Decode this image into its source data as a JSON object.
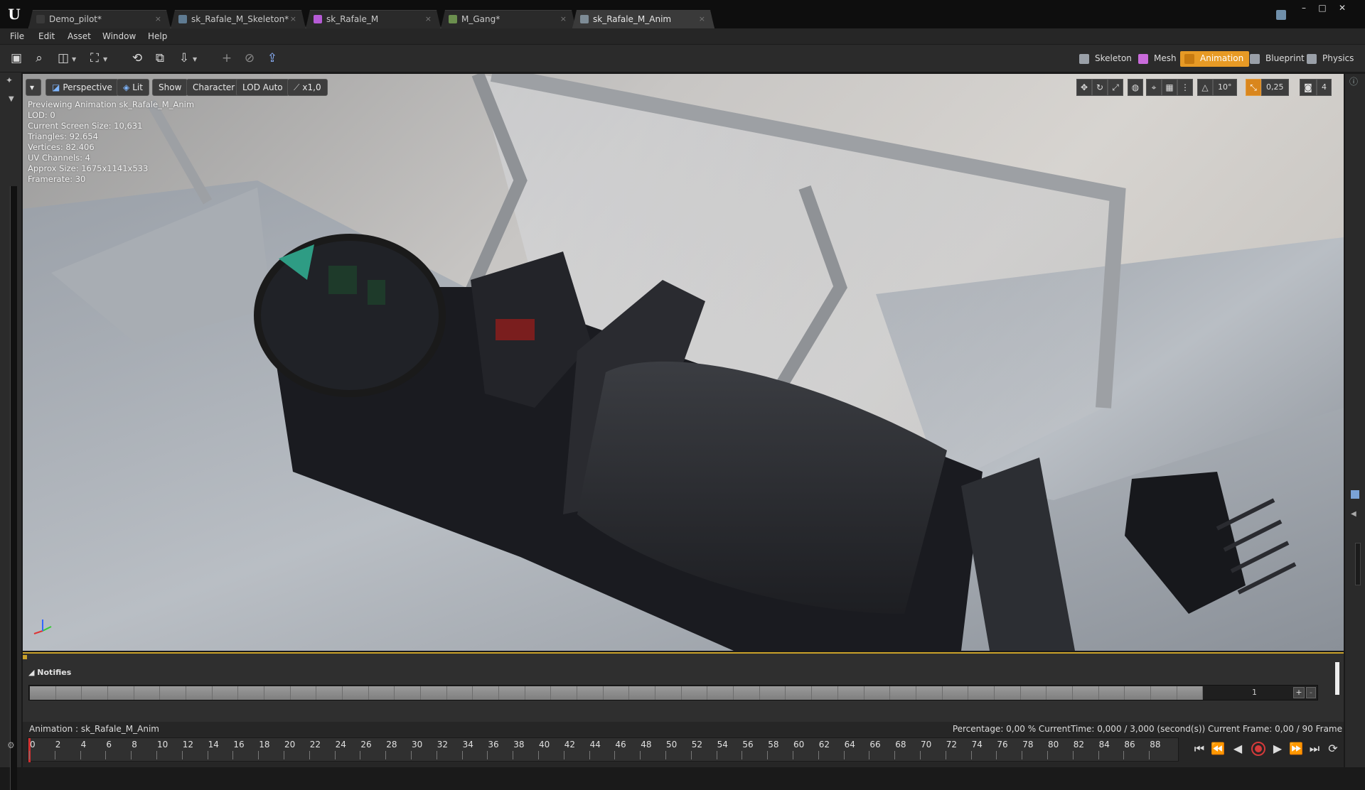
{
  "tabs": [
    {
      "label": "Demo_pilot*",
      "icon": "level-icon",
      "color": "#3a3a3a",
      "active": false
    },
    {
      "label": "sk_Rafale_M_Skeleton*",
      "icon": "skeleton-icon",
      "color": "#5f7b92",
      "active": false
    },
    {
      "label": "sk_Rafale_M",
      "icon": "mesh-icon",
      "color": "#b65bd6",
      "active": false
    },
    {
      "label": "M_Gang*",
      "icon": "material-icon",
      "color": "#6b8f4e",
      "active": false
    },
    {
      "label": "sk_Rafale_M_Anim",
      "icon": "animation-icon",
      "color": "#7e8c96",
      "active": true
    }
  ],
  "menu": [
    "File",
    "Edit",
    "Asset",
    "Window",
    "Help"
  ],
  "toolbar_icons": [
    "save-icon",
    "browse-icon",
    "camera-icon",
    "preview-mesh-icon",
    "reimport-icon",
    "make-static-icon",
    "import-icon",
    "create-asset-icon",
    "compress-icon",
    "export-icon"
  ],
  "modes": [
    {
      "label": "Skeleton",
      "icon": "skeleton-mode-icon",
      "active": false
    },
    {
      "label": "Mesh",
      "icon": "mesh-mode-icon",
      "active": false
    },
    {
      "label": "Animation",
      "icon": "animation-mode-icon",
      "active": true
    },
    {
      "label": "Blueprint",
      "icon": "blueprint-mode-icon",
      "active": false
    },
    {
      "label": "Physics",
      "icon": "physics-mode-icon",
      "active": false
    }
  ],
  "viewport": {
    "perspective": "Perspective",
    "lit": "Lit",
    "show": "Show",
    "character": "Character",
    "lod": "LOD Auto",
    "speed": "x1,0",
    "grid_angle": "10°",
    "scale": "0,25",
    "camera_speed": "4",
    "stats": [
      "Previewing Animation sk_Rafale_M_Anim",
      "LOD: 0",
      "Current Screen Size: 10,631",
      "Triangles: 92.654",
      "Vertices: 82.406",
      "UV Channels: 4",
      "Approx Size: 1675x1141x533",
      "Framerate: 30"
    ]
  },
  "notifies": {
    "title": "Notifies",
    "track_number": "1",
    "plus": "+",
    "minus": "-"
  },
  "animation_bar": {
    "label": "Animation :  sk_Rafale_M_Anim",
    "info": "Percentage:  0,00 %  CurrentTime:  0,000 / 3,000 (second(s))  Current Frame:  0,00 / 90 Frame"
  },
  "timeline": {
    "ticks": [
      "0",
      "2",
      "4",
      "6",
      "8",
      "10",
      "12",
      "14",
      "16",
      "18",
      "20",
      "22",
      "24",
      "26",
      "28",
      "30",
      "32",
      "34",
      "36",
      "38",
      "40",
      "42",
      "44",
      "46",
      "48",
      "50",
      "52",
      "54",
      "56",
      "58",
      "60",
      "62",
      "64",
      "66",
      "68",
      "70",
      "72",
      "74",
      "76",
      "78",
      "80",
      "82",
      "84",
      "86",
      "88"
    ],
    "current_frame": 0,
    "total_frames": 90
  },
  "colors": {
    "accent": "#e79a25",
    "playhead": "#d32f2f"
  }
}
